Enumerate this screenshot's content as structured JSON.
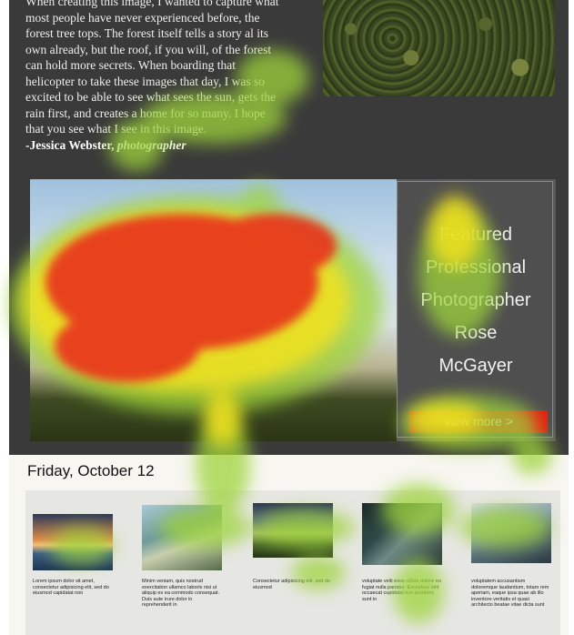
{
  "story": {
    "lines": [
      "When creating this image, I wanted to capture what",
      "most people have never experienced before, the",
      "forest tree tops. The forest itself tells a story al its",
      "own already, but the roof, if you will, of the forest",
      "can hold more secrets. When boarding that",
      "helicopter to take these images that day, I was so",
      "excited to be able to see what sees the sun, gets the",
      "rain first, and creates a home for so many. I hope",
      "that you see what I see in this image."
    ],
    "signature_name": "-Jessica Webster, ",
    "signature_role": "photographer"
  },
  "feature": {
    "title_lines": [
      "Featured",
      "Professional",
      "Photographer",
      "Rose",
      "McGayer"
    ],
    "button_label": "view more >"
  },
  "date_heading": "Friday, October 12",
  "gallery": [
    {
      "caption": "Lorem ipsum dolor sit amet, consectetur adipisicing elit, sed do eiusmod capidatat non"
    },
    {
      "caption": "Minim veniam, quis nostrud exercitation ullamco laboris nisi ut aliquip ex ea commodo consequat. Duis aute irure dolor in reprehenderit in"
    },
    {
      "caption": "Consectetur adipisicing elit, sed do eiusmod"
    },
    {
      "caption": "voluptate velit esse cillum dolore eu fugiat nulla pariatur. Excepteur sint occaecat cupidatat non proident, sunt in"
    },
    {
      "caption": "voluptatem accusantium doloremque laudantium, totam rem aperiam, eaque ipsa quae ab illo inventore veritatis et quasi architecto beatae vitae dicta sunt"
    }
  ],
  "colors": {
    "page_dark": "#3a3a3a",
    "button_red": "#e41e12",
    "heat_hot": "#e8321e",
    "heat_mid": "#f2e21c",
    "heat_cool": "#9ed43a"
  }
}
